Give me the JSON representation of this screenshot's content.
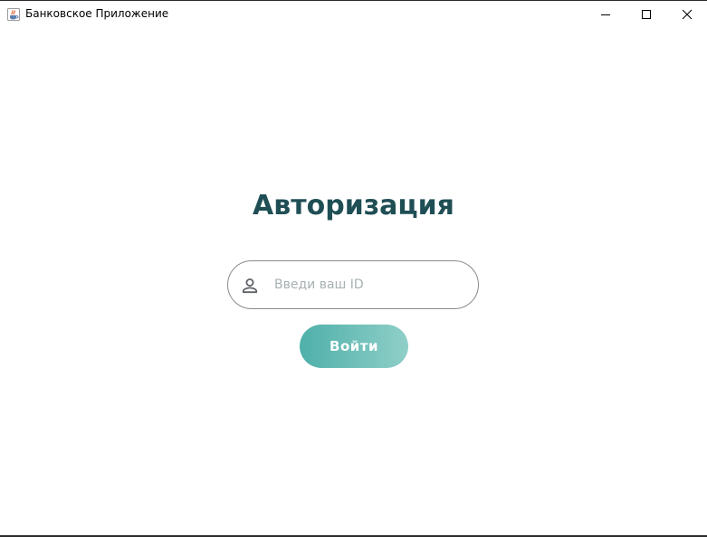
{
  "window": {
    "title": "Банковское Приложение",
    "icon": "java-cup-icon",
    "controls": [
      "minimize-icon",
      "maximize-icon",
      "close-icon"
    ]
  },
  "login": {
    "heading": "Авторизация",
    "id_input": {
      "value": "",
      "placeholder": "Введи ваш ID",
      "icon": "user-icon"
    },
    "submit_label": "Войти"
  },
  "colors": {
    "heading": "#1f4e55",
    "button_gradient_start": "#4fb0aa",
    "button_gradient_end": "#8fcfc8",
    "placeholder": "#a7b0b2",
    "input_border": "#8a8a8a"
  }
}
